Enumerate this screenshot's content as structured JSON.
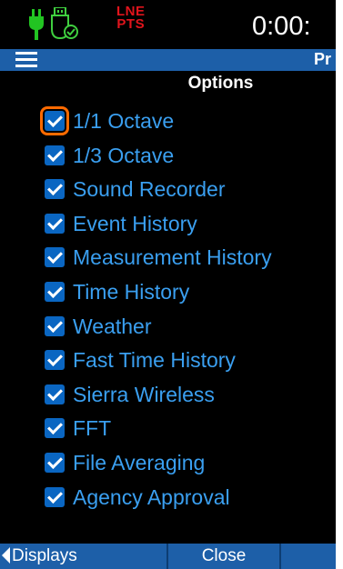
{
  "status": {
    "logo_line1": "LNE",
    "logo_line2": "PTS",
    "clock": "0:00:"
  },
  "header": {
    "title": "Pr"
  },
  "options": {
    "title": "Options",
    "items": [
      {
        "label": "1/1 Octave",
        "checked": true
      },
      {
        "label": "1/3 Octave",
        "checked": true
      },
      {
        "label": "Sound Recorder",
        "checked": true
      },
      {
        "label": "Event History",
        "checked": true
      },
      {
        "label": "Measurement History",
        "checked": true
      },
      {
        "label": "Time History",
        "checked": true
      },
      {
        "label": "Weather",
        "checked": true
      },
      {
        "label": "Fast Time History",
        "checked": true
      },
      {
        "label": "Sierra Wireless",
        "checked": true
      },
      {
        "label": "FFT",
        "checked": true
      },
      {
        "label": "File Averaging",
        "checked": true
      },
      {
        "label": "Agency Approval",
        "checked": true
      }
    ]
  },
  "bottom_bar": {
    "displays_label": "Displays",
    "close_label": "Close",
    "right_label": ""
  },
  "colors": {
    "background": "#000000",
    "bar": "#1d5fa8",
    "label": "#3a9ff0",
    "checkbox": "#0a66c2",
    "focus": "#ff6a00",
    "logo": "#e0141c"
  }
}
